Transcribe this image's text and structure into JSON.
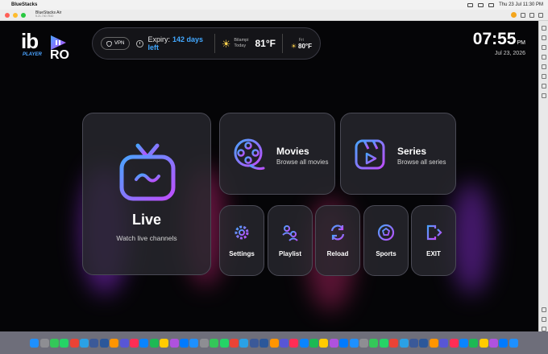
{
  "menubar": {
    "app_name": "BlueStacks",
    "datetime": "Thu 23 Jul  11:30 PM"
  },
  "window": {
    "title": "BlueStacks Air",
    "subtitle": "5.21.740.7510"
  },
  "logo": {
    "ib": "ib",
    "player": "PLAYER",
    "pro": "RO"
  },
  "status": {
    "vpn_label": "VPN",
    "expiry_label": "Expiry:",
    "expiry_value": "142 days left",
    "weather_place": "Bilampi",
    "weather_day": "Today",
    "weather_temp": "81°F",
    "forecast_day": "Fri",
    "forecast_temp": "80°F"
  },
  "clock": {
    "time": "07:55",
    "ampm": "PM",
    "date": "Jul 23, 2026"
  },
  "tiles": {
    "live": {
      "title": "Live",
      "subtitle": "Watch live channels"
    },
    "movies": {
      "title": "Movies",
      "subtitle": "Browse all movies"
    },
    "series": {
      "title": "Series",
      "subtitle": "Browse all series"
    },
    "settings": {
      "title": "Settings"
    },
    "playlist": {
      "title": "Playlist"
    },
    "reload": {
      "title": "Reload"
    },
    "sports": {
      "title": "Sports"
    },
    "exit": {
      "title": "EXIT"
    }
  },
  "colors": {
    "accent_blue": "#42a8ff",
    "accent_purple": "#b04dff",
    "tile_bg": "#28282e"
  },
  "dock_apps": [
    "finder",
    "launchpad",
    "safari",
    "messages",
    "whatsapp",
    "chrome",
    "mail",
    "telegram",
    "facebook",
    "word",
    "keynote",
    "photos",
    "finder2",
    "calculator",
    "appstore",
    "excel",
    "music",
    "spotify",
    "maps",
    "settings",
    "notes",
    "contacts",
    "facetime",
    "calendar",
    "vscode",
    "terminal",
    "preview",
    "pages",
    "numbers",
    "zoom",
    "powerpoint",
    "textedit",
    "xcode",
    "photoshop",
    "illustrator",
    "bluestacks",
    "teams",
    "notion",
    "slack",
    "tv",
    "maps2",
    "vlc",
    "discord",
    "skype",
    "outlook",
    "music2",
    "books",
    "reminders",
    "trash"
  ]
}
